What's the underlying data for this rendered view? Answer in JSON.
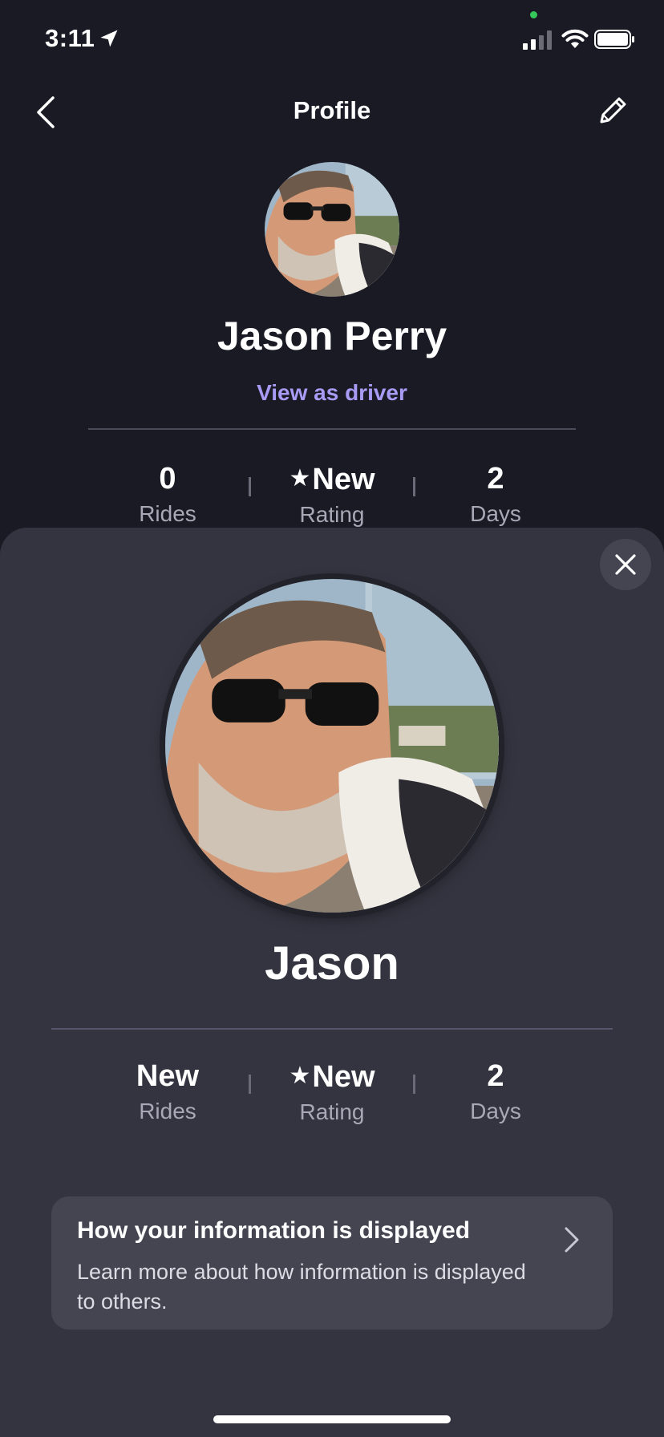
{
  "status_bar": {
    "time": "3:11"
  },
  "header": {
    "title": "Profile"
  },
  "profile": {
    "full_name": "Jason Perry",
    "view_as_driver_label": "View as driver",
    "stats": [
      {
        "value": "0",
        "label": "Rides"
      },
      {
        "value": "New",
        "label": "Rating",
        "star": "★"
      },
      {
        "value": "2",
        "label": "Days"
      }
    ]
  },
  "driver_view_sheet": {
    "first_name": "Jason",
    "stats": [
      {
        "value": "New",
        "label": "Rides"
      },
      {
        "value": "New",
        "label": "Rating",
        "star": "★"
      },
      {
        "value": "2",
        "label": "Days"
      }
    ],
    "info_card": {
      "title": "How your information is displayed",
      "description": "Learn more about how information is displayed to others."
    }
  },
  "icons": {
    "back": "chevron-left-icon",
    "edit": "pencil-icon",
    "close": "close-icon",
    "info_chevron": "chevron-right-icon",
    "location": "location-arrow-icon",
    "signal": "cellular-signal-icon",
    "wifi": "wifi-icon",
    "battery": "battery-icon"
  },
  "colors": {
    "background": "#1a1a24",
    "sheet": "#343440",
    "card": "#454552",
    "accent_link": "#a79bf5",
    "secondary_text": "#a8a8b6",
    "mic_indicator": "#34c759"
  }
}
